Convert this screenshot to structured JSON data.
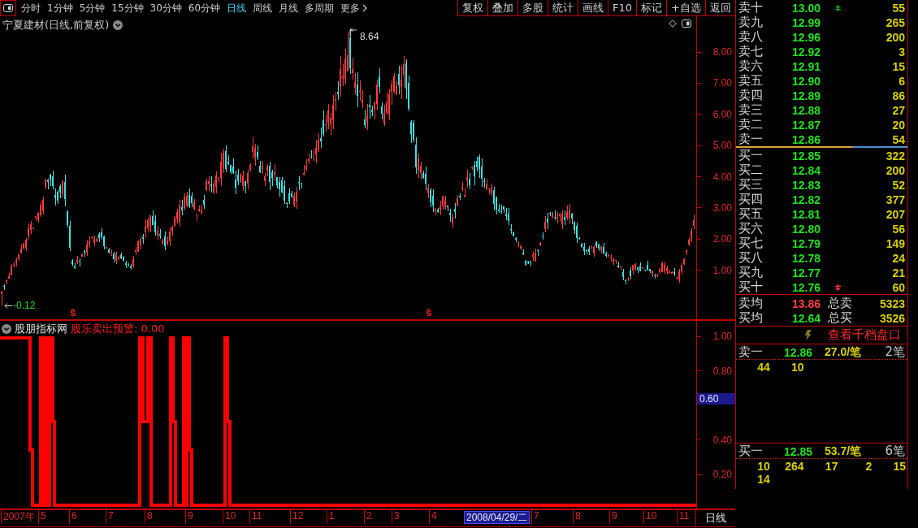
{
  "toolbar": {
    "periods": [
      {
        "label": "分时",
        "kind": "period",
        "selected": false
      },
      {
        "label": "1分钟",
        "kind": "period",
        "selected": false
      },
      {
        "label": "5分钟",
        "kind": "period",
        "selected": false
      },
      {
        "label": "15分钟",
        "kind": "period",
        "selected": false
      },
      {
        "label": "30分钟",
        "kind": "period",
        "selected": false
      },
      {
        "label": "60分钟",
        "kind": "period",
        "selected": false
      },
      {
        "label": "日线",
        "kind": "period",
        "selected": true
      },
      {
        "label": "周线",
        "kind": "period",
        "selected": false
      },
      {
        "label": "月线",
        "kind": "period",
        "selected": false
      },
      {
        "label": "多周期",
        "kind": "period",
        "selected": false
      },
      {
        "label": "更多",
        "kind": "menu",
        "selected": false
      }
    ],
    "tools": [
      "复权",
      "叠加",
      "多股",
      "统计",
      "画线",
      "F10",
      "标记",
      "+自选",
      "返回"
    ]
  },
  "price_chart": {
    "title": "宁夏建材(日线,前复权)",
    "high_label": "8.64",
    "low_label": "-0.12",
    "signal_markers": [
      "ŝ",
      "ŝ"
    ],
    "axis_labels": [
      "8.00",
      "7.00",
      "6.00",
      "5.00",
      "4.00",
      "3.00",
      "2.00",
      "1.00"
    ]
  },
  "indicator": {
    "name": "股朋指标网",
    "reading": "股乐卖出预警: 0.00",
    "axis_labels": [
      {
        "label": "1.00",
        "highlighted": false
      },
      {
        "label": "0.80",
        "highlighted": false
      },
      {
        "label": "0.60",
        "highlighted": true
      },
      {
        "label": "0.40",
        "highlighted": false
      },
      {
        "label": "0.20",
        "highlighted": false
      }
    ]
  },
  "date_axis": {
    "labels": [
      {
        "label": "2007年",
        "highlighted": false
      },
      {
        "label": "5",
        "highlighted": false
      },
      {
        "label": "6",
        "highlighted": false
      },
      {
        "label": "7",
        "highlighted": false
      },
      {
        "label": "8",
        "highlighted": false
      },
      {
        "label": "9",
        "highlighted": false
      },
      {
        "label": "10",
        "highlighted": false
      },
      {
        "label": "11",
        "highlighted": false
      },
      {
        "label": "12",
        "highlighted": false
      },
      {
        "label": "1",
        "highlighted": false
      },
      {
        "label": "2",
        "highlighted": false
      },
      {
        "label": "3",
        "highlighted": false
      },
      {
        "label": "4",
        "highlighted": false
      },
      {
        "label": "2008/04/29/二",
        "highlighted": true
      },
      {
        "label": "7",
        "highlighted": false
      },
      {
        "label": "8",
        "highlighted": false
      },
      {
        "label": "9",
        "highlighted": false
      },
      {
        "label": "10",
        "highlighted": false
      },
      {
        "label": "11",
        "highlighted": false
      }
    ],
    "period": "日线"
  },
  "order_book": {
    "asks": [
      {
        "label": "卖十",
        "price": "13.00",
        "volume": "55",
        "limit": true
      },
      {
        "label": "卖九",
        "price": "12.99",
        "volume": "265",
        "limit": false
      },
      {
        "label": "卖八",
        "price": "12.96",
        "volume": "200",
        "limit": false
      },
      {
        "label": "卖七",
        "price": "12.92",
        "volume": "3",
        "limit": false
      },
      {
        "label": "卖六",
        "price": "12.91",
        "volume": "15",
        "limit": false
      },
      {
        "label": "卖五",
        "price": "12.90",
        "volume": "6",
        "limit": false
      },
      {
        "label": "卖四",
        "price": "12.89",
        "volume": "86",
        "limit": false
      },
      {
        "label": "卖三",
        "price": "12.88",
        "volume": "27",
        "limit": false
      },
      {
        "label": "卖二",
        "price": "12.87",
        "volume": "20",
        "limit": false
      },
      {
        "label": "卖一",
        "price": "12.86",
        "volume": "54",
        "limit": false
      }
    ],
    "ratio_bar": {
      "level": 0.68
    },
    "bids": [
      {
        "label": "买一",
        "price": "12.85",
        "volume": "322",
        "limit": false
      },
      {
        "label": "买二",
        "price": "12.84",
        "volume": "200",
        "limit": false
      },
      {
        "label": "买三",
        "price": "12.83",
        "volume": "52",
        "limit": false
      },
      {
        "label": "买四",
        "price": "12.82",
        "volume": "377",
        "limit": false
      },
      {
        "label": "买五",
        "price": "12.81",
        "volume": "207",
        "limit": false
      },
      {
        "label": "买六",
        "price": "12.80",
        "volume": "56",
        "limit": false
      },
      {
        "label": "买七",
        "price": "12.79",
        "volume": "149",
        "limit": false
      },
      {
        "label": "买八",
        "price": "12.78",
        "volume": "24",
        "limit": false
      },
      {
        "label": "买九",
        "price": "12.77",
        "volume": "21",
        "limit": false
      },
      {
        "label": "买十",
        "price": "12.76",
        "volume": "60",
        "limit": true
      }
    ],
    "summary": [
      {
        "label": "卖均",
        "price": "13.86",
        "rising": true,
        "total_label": "总卖",
        "total": "5323"
      },
      {
        "label": "买均",
        "price": "12.64",
        "rising": false,
        "total_label": "总买",
        "total": "3526"
      }
    ]
  },
  "queue": {
    "link": "查看千档盘口",
    "ask": {
      "label": "卖一",
      "price": "12.86",
      "average": "27.0/笔",
      "orders": "2笔",
      "volumes": [
        "44",
        "10"
      ]
    },
    "bid": {
      "label": "买一",
      "price": "12.85",
      "average": "53.7/笔",
      "orders": "6笔",
      "volumes": [
        "10",
        "264",
        "17",
        "2",
        "15",
        "14"
      ]
    }
  }
}
